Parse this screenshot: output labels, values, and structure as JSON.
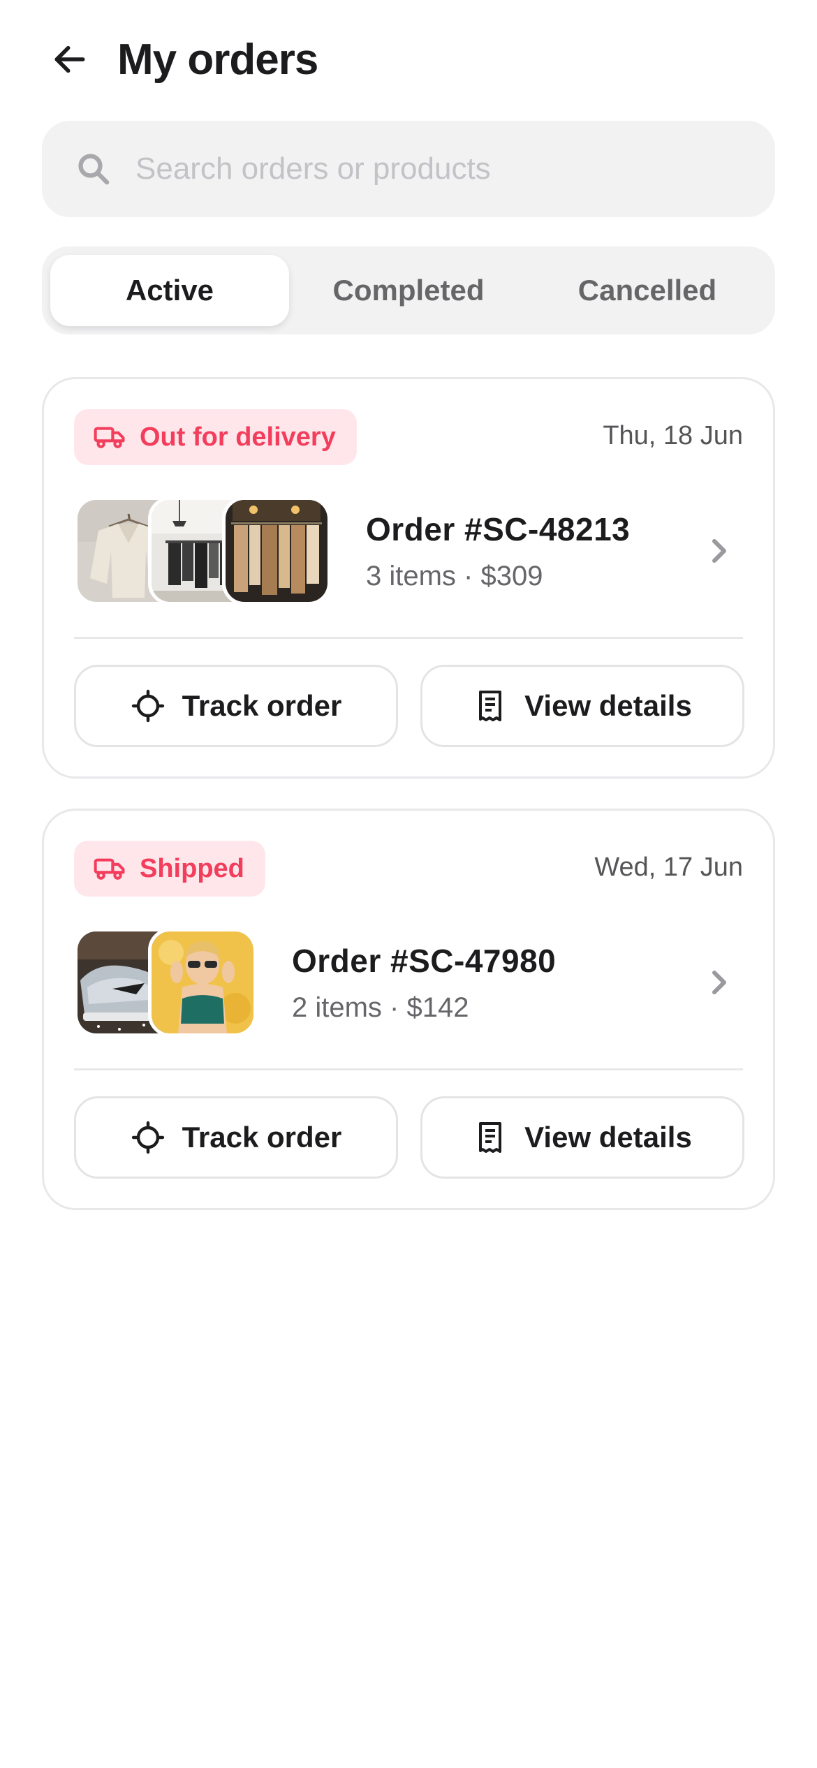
{
  "header": {
    "title": "My orders",
    "back_icon": "arrow-left-icon"
  },
  "search": {
    "placeholder": "Search orders or products",
    "value": "",
    "icon": "search-icon"
  },
  "tabs": [
    {
      "label": "Active",
      "selected": true
    },
    {
      "label": "Completed",
      "selected": false
    },
    {
      "label": "Cancelled",
      "selected": false
    }
  ],
  "orders": [
    {
      "status": "Out for delivery",
      "status_icon": "truck-icon",
      "date": "Thu, 18 Jun",
      "order_id": "Order #SC-48213",
      "summary": "3 items · $309",
      "thumbnails": [
        "knit-sweater-on-hanger",
        "clothing-rack-store",
        "boutique-garments-rack"
      ],
      "actions": {
        "track": "Track order",
        "details": "View details"
      }
    },
    {
      "status": "Shipped",
      "status_icon": "truck-icon",
      "date": "Wed, 17 Jun",
      "order_id": "Order #SC-47980",
      "summary": "2 items · $142",
      "thumbnails": [
        "grey-sneakers",
        "woman-with-sunglasses-yellow"
      ],
      "actions": {
        "track": "Track order",
        "details": "View details"
      }
    }
  ],
  "colors": {
    "accent": "#f23d5c",
    "badge_bg": "#ffe6ea",
    "surface": "#f2f2f3",
    "text_primary": "#1c1c1e",
    "text_secondary": "#66666a"
  }
}
